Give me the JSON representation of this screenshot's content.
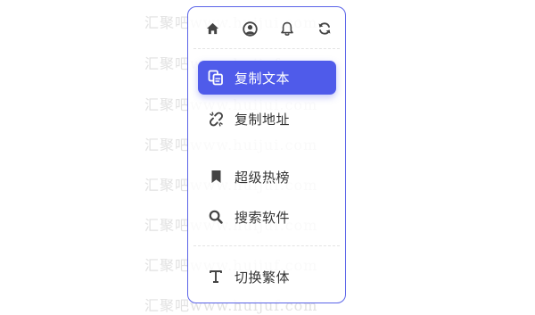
{
  "watermark": {
    "lines": [
      "汇聚吧www.huijui.com",
      "汇聚吧www.huijuf.com",
      "汇聚吧www.huijui.com",
      "汇聚吧www.huijui.com",
      "汇聚吧www.huijuf.com",
      "汇聚吧www.huijuf.com",
      "汇聚吧www.huijuf.com",
      "汇聚吧www.huijuf.com"
    ]
  },
  "menu": {
    "top_icons": [
      "home-icon",
      "user-circle-icon",
      "bell-icon",
      "refresh-icon"
    ],
    "items": [
      {
        "label": "复制文本",
        "icon": "copy-icon",
        "active": true
      },
      {
        "label": "复制地址",
        "icon": "unlink-icon",
        "active": false
      },
      {
        "label": "超级热榜",
        "icon": "bookmark-icon",
        "active": false
      },
      {
        "label": "搜索软件",
        "icon": "search-icon",
        "active": false
      },
      {
        "label": "切换繁体",
        "icon": "text-icon",
        "active": false
      }
    ]
  },
  "colors": {
    "accent": "#4f5bea",
    "border": "#5b64e8",
    "icon": "#444444",
    "text": "#333333"
  }
}
